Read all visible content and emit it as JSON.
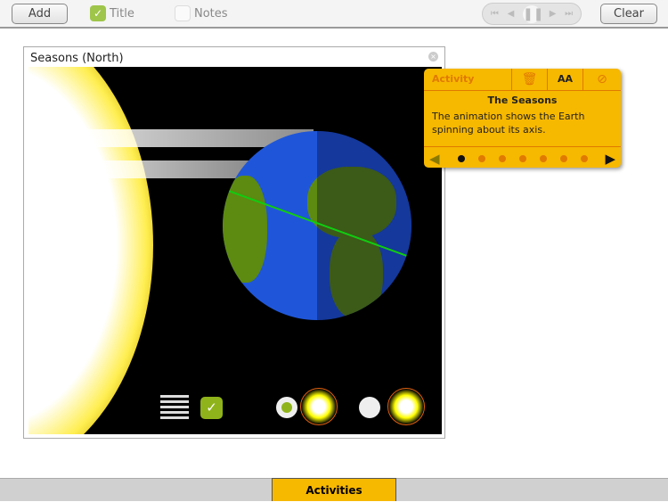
{
  "toolbar": {
    "add_label": "Add",
    "title_label": "Title",
    "title_checked": true,
    "notes_label": "Notes",
    "notes_checked": false,
    "clear_label": "Clear"
  },
  "panel": {
    "title": "Seasons (North)"
  },
  "card": {
    "tab_label": "Activity",
    "font_icon": "AA",
    "title": "The Seasons",
    "body": "The animation shows the Earth spinning about its axis.",
    "page_index": 1,
    "page_count": 7
  },
  "bottom": {
    "tab_label": "Activities"
  }
}
